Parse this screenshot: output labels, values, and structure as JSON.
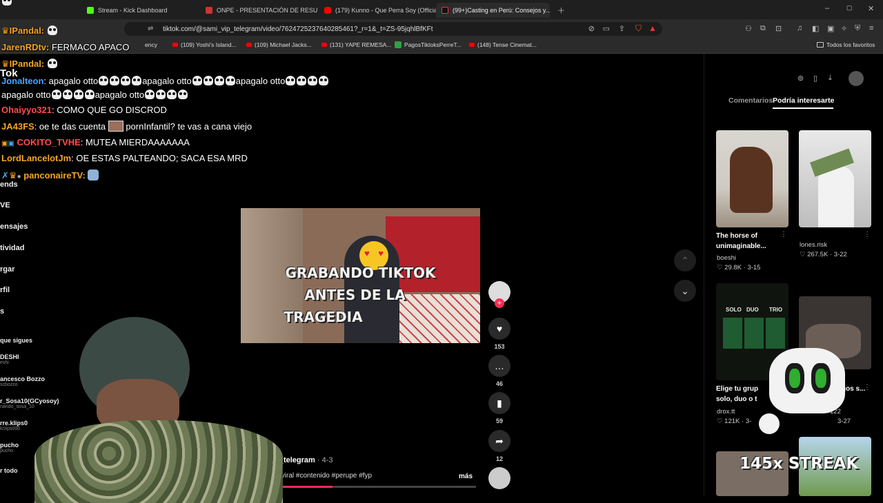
{
  "browser": {
    "tabs": [
      {
        "label": "Stream - Kick Dashboard"
      },
      {
        "label": "ONPE - PRESENTACIÓN DE RESULTA..."
      },
      {
        "label": "(179) Kunno - Que Perra Soy (Official..."
      },
      {
        "label": "(99+)Casting en Perú: Consejos y..."
      }
    ],
    "url": "tiktok.com/@sami_vip_telegram/video/7624725237640285461?_r=1&_t=ZS-95jqhlBfKFt",
    "bookmarks": [
      {
        "label": "ency"
      },
      {
        "label": "(109) Yoshi's Island..."
      },
      {
        "label": "(109) Michael Jacks..."
      },
      {
        "label": "(131) YAPE REMESA..."
      },
      {
        "label": "PagosTiktoksPerreT..."
      },
      {
        "label": "(148) Tense Cinemat..."
      }
    ],
    "all_bookmarks": "Todos los favoritos"
  },
  "chat": {
    "messages": [
      {
        "user": "IPandal:",
        "text": ""
      },
      {
        "user": "JarenRDtv:",
        "text": "FERMACO APACO"
      },
      {
        "user": "IPandal:",
        "text": ""
      },
      {
        "user": "Jonalteon",
        "text": ": apagalo otto",
        "text2": "apagalo otto",
        "text3": "apagalo otto",
        "line2a": "apagalo otto",
        "line2b": "apagalo otto"
      },
      {
        "user": "Ohaiyyo321",
        "text": ": COMO QUE GO DISCROD"
      },
      {
        "user": "JA43FS",
        "text": ": oe te das cuenta",
        "text2": "pornInfantil? te vas a cana viejo"
      },
      {
        "user": "COKITO_TVHE",
        "text": ": MUTEA MIERDAAAAAAA"
      },
      {
        "user": "LordLancelotJm",
        "text": ": OE ESTAS PALTEANDO; SACA ESA MRD"
      },
      {
        "user": "panconaireTV:",
        "text": ""
      }
    ]
  },
  "sidebar": {
    "items": [
      {
        "label": "Tok"
      },
      {
        "label": "ends"
      },
      {
        "label": "VE"
      },
      {
        "label": "ensajes"
      },
      {
        "label": "tividad"
      },
      {
        "label": "rgar"
      },
      {
        "label": "rfil"
      },
      {
        "label": "s"
      }
    ],
    "following_title": "que sigues",
    "following": [
      {
        "name": "DESHI",
        "sub": "eshi"
      },
      {
        "name": "ancesco Bozzo",
        "sub": "scbozzo"
      },
      {
        "name": "r_Sosa10(GCyosoy)",
        "sub": "nando_sosa_10"
      },
      {
        "name": "rre.klips0",
        "sub": "kclips000"
      },
      {
        "name": "pucho",
        "sub": "pucho"
      },
      {
        "name": "r todo",
        "sub": ""
      }
    ]
  },
  "video": {
    "caption_lines": [
      "GRABANDO TIKTOK",
      "ANTES DE LA",
      "TRAGEDIA"
    ],
    "author": "mi_vip_telegram",
    "date": "4-3",
    "description": "g #videoviral #contenido #perupe #fyp",
    "more": "más",
    "likes": "153",
    "comments": "46",
    "saves": "59",
    "shares": "12"
  },
  "right": {
    "tabs": {
      "comments": "Comentarios",
      "suggested": "Podría interesarte"
    },
    "cards": [
      {
        "title": "The horse of unimaginable...",
        "user": "boeshi",
        "likes": "29.8K",
        "date": "3-15"
      },
      {
        "title": "",
        "user": "lones.risk",
        "likes": "267.5K",
        "date": "3-22"
      },
      {
        "title": "Elige tu grup solo, duo o t",
        "user": "drox.tt",
        "likes": "121K",
        "date": "3-"
      },
      {
        "title": "gos s...",
        "user": "122",
        "likes": "",
        "date": "3-27"
      }
    ],
    "thumb_labels": {
      "solo": "SOLO",
      "duo": "DUO",
      "trio": "TRIO"
    }
  },
  "overlay": {
    "streak": "145x STREAK"
  },
  "colors": {
    "accent": "#fe2c55",
    "chat_blue": "#4aa3ff",
    "chat_orange": "#f5a623",
    "chat_red": "#ff4d4d"
  }
}
